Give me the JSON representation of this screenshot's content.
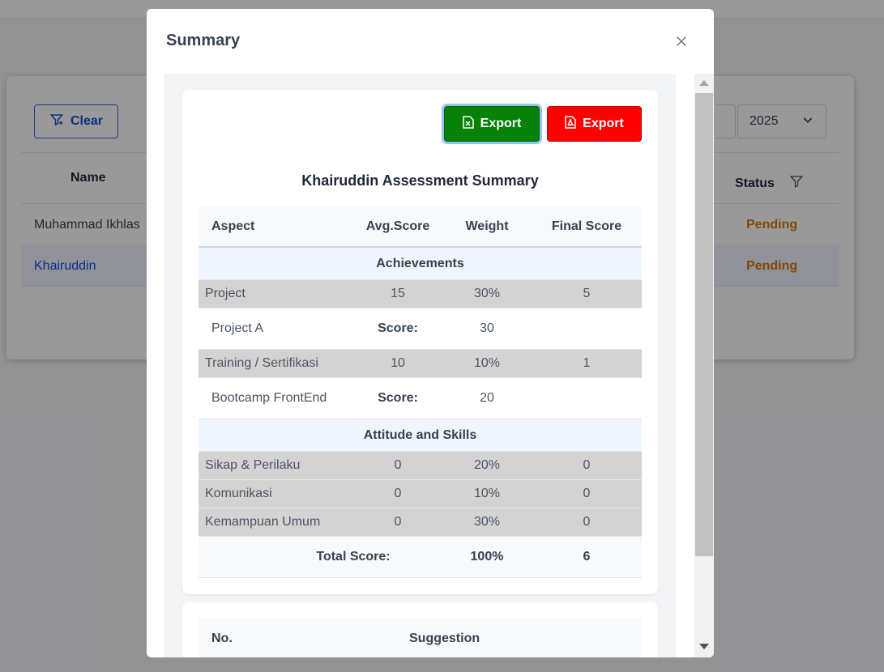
{
  "background": {
    "clear_label": "Clear",
    "year_value": "2025",
    "table_headers": {
      "name": "Name",
      "status": "Status"
    },
    "rows": [
      {
        "name": "Muhammad Ikhlas",
        "status": "Pending"
      },
      {
        "name": "Khairuddin",
        "status": "Pending"
      }
    ]
  },
  "modal": {
    "title": "Summary",
    "export_excel_label": "Export",
    "export_pdf_label": "Export",
    "summary_title": "Khairuddin Assessment Summary",
    "table": {
      "headers": {
        "aspect": "Aspect",
        "avg_score": "Avg.Score",
        "weight": "Weight",
        "final_score": "Final Score"
      },
      "sections": [
        {
          "title": "Achievements",
          "aspects": [
            {
              "name": "Project",
              "avg": "15",
              "weight": "30%",
              "final": "5",
              "detail": {
                "name": "Project A",
                "score_label": "Score:",
                "score": "30"
              }
            },
            {
              "name": "Training / Sertifikasi",
              "avg": "10",
              "weight": "10%",
              "final": "1",
              "detail": {
                "name": "Bootcamp FrontEnd",
                "score_label": "Score:",
                "score": "20"
              }
            }
          ]
        },
        {
          "title": "Attitude and Skills",
          "aspects": [
            {
              "name": "Sikap & Perilaku",
              "avg": "0",
              "weight": "20%",
              "final": "0"
            },
            {
              "name": "Komunikasi",
              "avg": "0",
              "weight": "10%",
              "final": "0"
            },
            {
              "name": "Kemampuan Umum",
              "avg": "0",
              "weight": "30%",
              "final": "0"
            }
          ]
        }
      ],
      "total": {
        "label": "Total Score:",
        "weight": "100%",
        "final": "6"
      }
    },
    "suggestion_table": {
      "headers": {
        "no": "No.",
        "suggestion": "Suggestion"
      }
    }
  },
  "colors": {
    "excel": "#078107",
    "pdf": "#ff0000",
    "pending": "#d97706",
    "link": "#1d4ed8"
  }
}
